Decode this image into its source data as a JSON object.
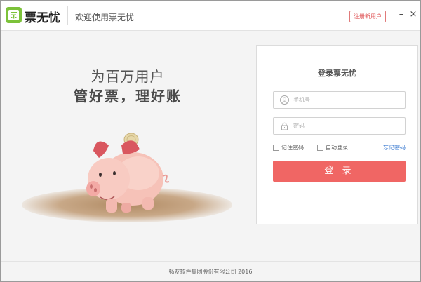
{
  "app": {
    "name": "票无忧",
    "welcome": "欢迎使用票无忧",
    "register_label": "注册新用户",
    "minimize_symbol": "–",
    "close_symbol": "×"
  },
  "hero": {
    "slogan_line1": "为百万用户",
    "slogan_line2": "管好票，理好账"
  },
  "login": {
    "title": "登录票无忧",
    "phone_placeholder": "手机号",
    "password_placeholder": "密码",
    "remember_label": "记住密码",
    "auto_login_label": "自动登录",
    "forgot_label": "忘记密码",
    "login_button": "登 录"
  },
  "footer": {
    "copyright": "畅友软件集团股份有限公司 2016"
  },
  "colors": {
    "brand_green": "#7cc23a",
    "accent_red": "#f06664",
    "link_blue": "#3a7ad0"
  }
}
